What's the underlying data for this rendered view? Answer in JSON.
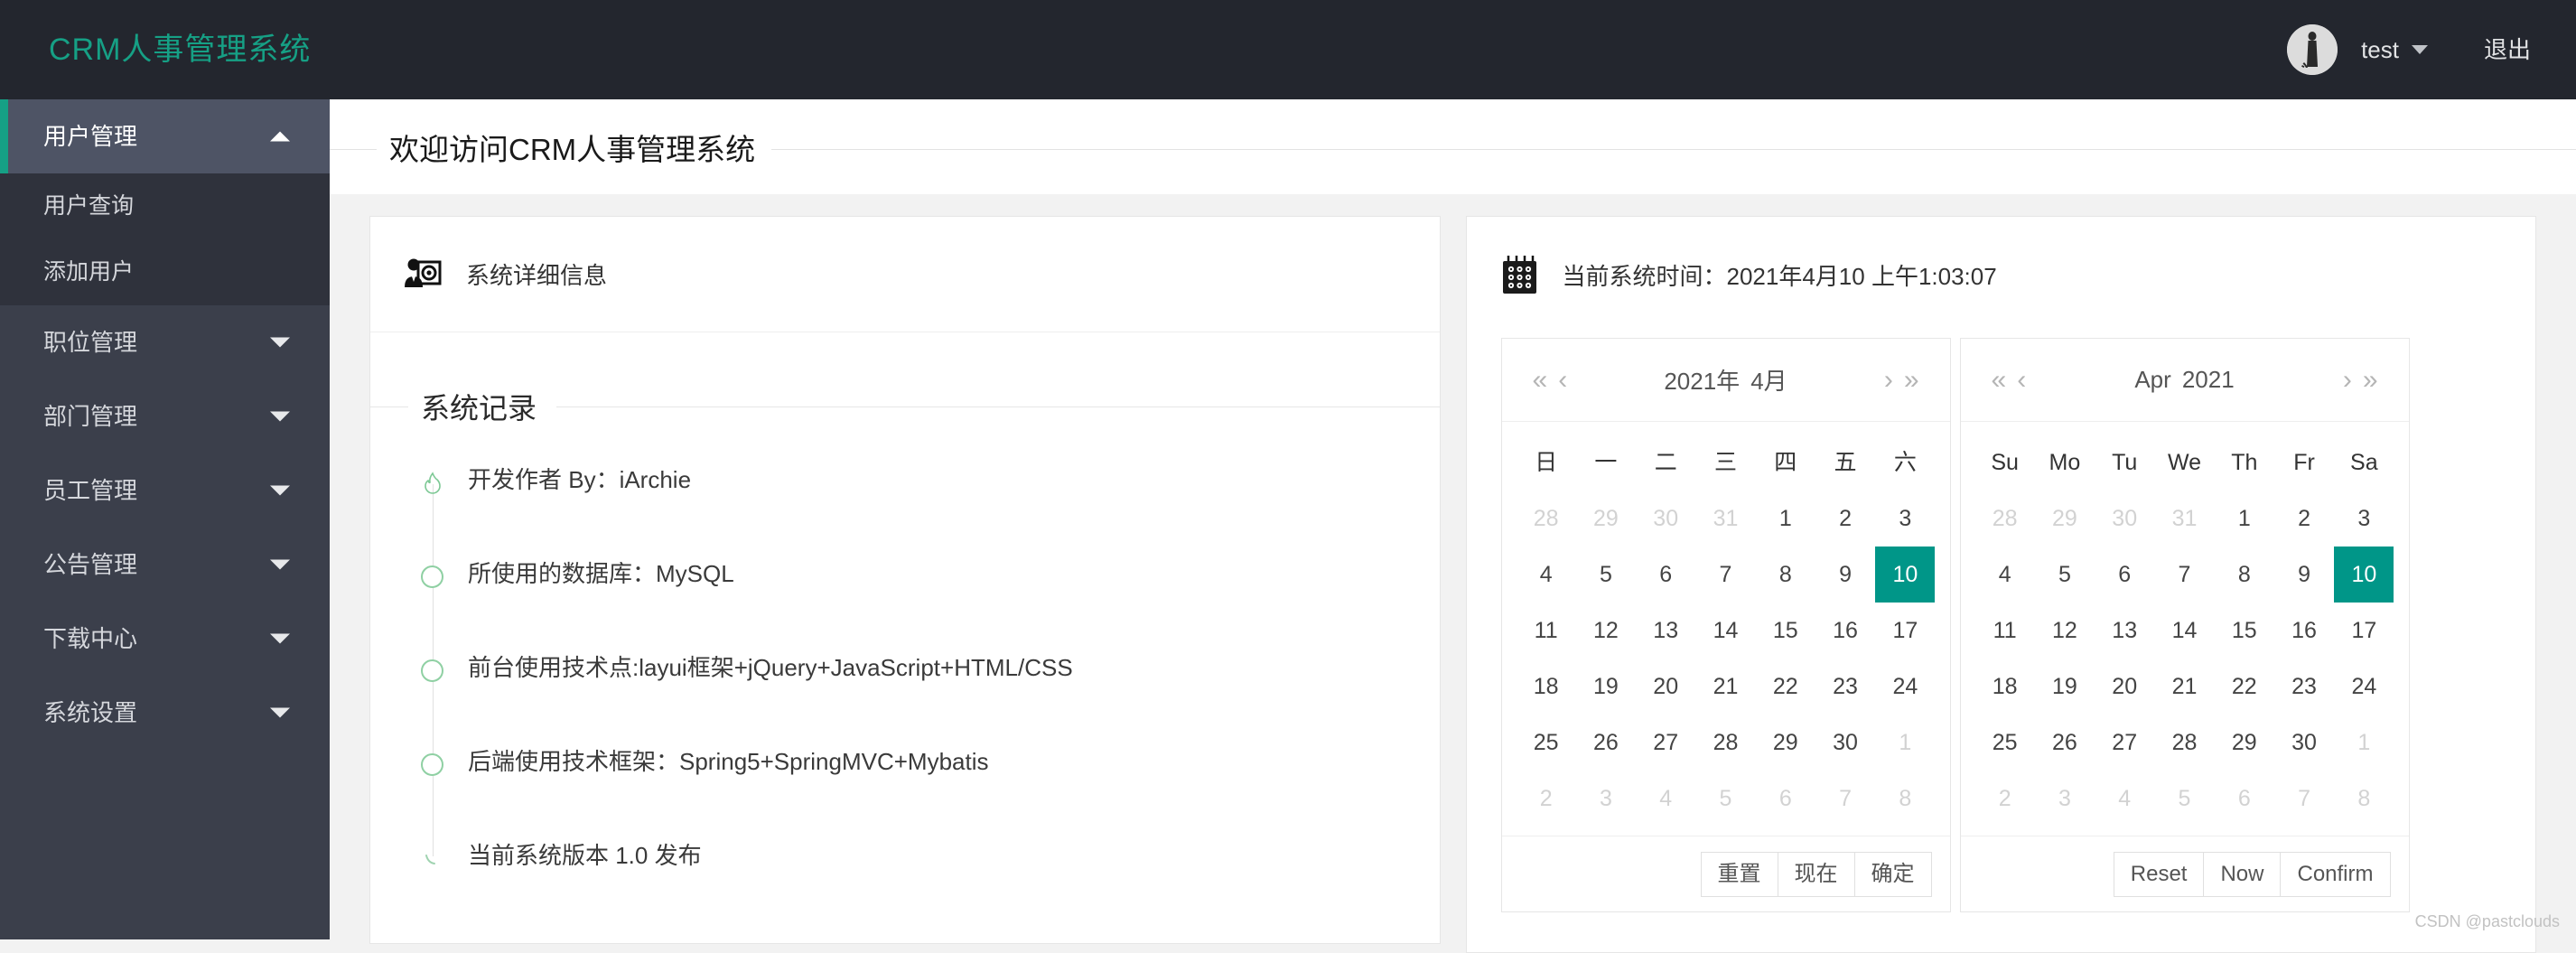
{
  "app": {
    "logo": "CRM人事管理系统",
    "accent_color": "#16a085",
    "today_color": "#009688",
    "header_bg": "#23262E",
    "sidebar_bg": "#3B3F4B"
  },
  "header": {
    "username": "test",
    "logout_label": "退出",
    "avatar_icon": "user-avatar-image"
  },
  "sidebar": {
    "items": [
      {
        "label": "用户管理",
        "state": "expanded",
        "arrow": "chevron-up-icon",
        "active": true
      },
      {
        "label": "职位管理",
        "state": "collapsed",
        "arrow": "chevron-down-icon",
        "active": false
      },
      {
        "label": "部门管理",
        "state": "collapsed",
        "arrow": "chevron-down-icon",
        "active": false
      },
      {
        "label": "员工管理",
        "state": "collapsed",
        "arrow": "chevron-down-icon",
        "active": false
      },
      {
        "label": "公告管理",
        "state": "collapsed",
        "arrow": "chevron-down-icon",
        "active": false
      },
      {
        "label": "下载中心",
        "state": "collapsed",
        "arrow": "chevron-down-icon",
        "active": false
      },
      {
        "label": "系统设置",
        "state": "collapsed",
        "arrow": "chevron-down-icon",
        "active": false
      }
    ],
    "submenu": [
      {
        "label": "用户查询"
      },
      {
        "label": "添加用户"
      }
    ]
  },
  "page": {
    "title": "欢迎访问CRM人事管理系统"
  },
  "left_card": {
    "head_icon": "user-settings-icon",
    "head_title": "系统详细信息",
    "section_title": "系统记录",
    "timeline": [
      {
        "icon": "flame-icon",
        "text": "开发作者 By：iArchie"
      },
      {
        "icon": "circle-icon",
        "text": "所使用的数据库：MySQL"
      },
      {
        "icon": "circle-icon",
        "text": "前台使用技术点:layui框架+jQuery+JavaScript+HTML/CSS"
      },
      {
        "icon": "circle-icon",
        "text": "后端使用技术框架：Spring5+SpringMVC+Mybatis"
      },
      {
        "icon": "crescent-icon",
        "text": "当前系统版本 1.0 发布"
      }
    ]
  },
  "right_card": {
    "head_icon": "calendar-icon",
    "head_title": "当前系统时间：2021年4月10 上午1:03:07",
    "calendars": [
      {
        "id": "zh",
        "nav": {
          "prev_year": "«",
          "prev_month": "‹",
          "next_month": "›",
          "next_year": "»"
        },
        "title_parts": [
          "2021年",
          "4月"
        ],
        "weekdays": [
          "日",
          "一",
          "二",
          "三",
          "四",
          "五",
          "六"
        ],
        "weeks": [
          [
            {
              "d": "28",
              "m": 1
            },
            {
              "d": "29",
              "m": 1
            },
            {
              "d": "30",
              "m": 1
            },
            {
              "d": "31",
              "m": 1
            },
            {
              "d": "1",
              "m": 0
            },
            {
              "d": "2",
              "m": 0
            },
            {
              "d": "3",
              "m": 0
            }
          ],
          [
            {
              "d": "4",
              "m": 0
            },
            {
              "d": "5",
              "m": 0
            },
            {
              "d": "6",
              "m": 0
            },
            {
              "d": "7",
              "m": 0
            },
            {
              "d": "8",
              "m": 0
            },
            {
              "d": "9",
              "m": 0
            },
            {
              "d": "10",
              "m": 0,
              "t": 1
            }
          ],
          [
            {
              "d": "11",
              "m": 0
            },
            {
              "d": "12",
              "m": 0
            },
            {
              "d": "13",
              "m": 0
            },
            {
              "d": "14",
              "m": 0
            },
            {
              "d": "15",
              "m": 0
            },
            {
              "d": "16",
              "m": 0
            },
            {
              "d": "17",
              "m": 0
            }
          ],
          [
            {
              "d": "18",
              "m": 0
            },
            {
              "d": "19",
              "m": 0
            },
            {
              "d": "20",
              "m": 0
            },
            {
              "d": "21",
              "m": 0
            },
            {
              "d": "22",
              "m": 0
            },
            {
              "d": "23",
              "m": 0
            },
            {
              "d": "24",
              "m": 0
            }
          ],
          [
            {
              "d": "25",
              "m": 0
            },
            {
              "d": "26",
              "m": 0
            },
            {
              "d": "27",
              "m": 0
            },
            {
              "d": "28",
              "m": 0
            },
            {
              "d": "29",
              "m": 0
            },
            {
              "d": "30",
              "m": 0
            },
            {
              "d": "1",
              "m": 1
            }
          ],
          [
            {
              "d": "2",
              "m": 1
            },
            {
              "d": "3",
              "m": 1
            },
            {
              "d": "4",
              "m": 1
            },
            {
              "d": "5",
              "m": 1
            },
            {
              "d": "6",
              "m": 1
            },
            {
              "d": "7",
              "m": 1
            },
            {
              "d": "8",
              "m": 1
            }
          ]
        ],
        "buttons": [
          "重置",
          "现在",
          "确定"
        ]
      },
      {
        "id": "en",
        "nav": {
          "prev_year": "«",
          "prev_month": "‹",
          "next_month": "›",
          "next_year": "»"
        },
        "title_parts": [
          "Apr",
          "2021"
        ],
        "weekdays": [
          "Su",
          "Mo",
          "Tu",
          "We",
          "Th",
          "Fr",
          "Sa"
        ],
        "weeks": [
          [
            {
              "d": "28",
              "m": 1
            },
            {
              "d": "29",
              "m": 1
            },
            {
              "d": "30",
              "m": 1
            },
            {
              "d": "31",
              "m": 1
            },
            {
              "d": "1",
              "m": 0
            },
            {
              "d": "2",
              "m": 0
            },
            {
              "d": "3",
              "m": 0
            }
          ],
          [
            {
              "d": "4",
              "m": 0
            },
            {
              "d": "5",
              "m": 0
            },
            {
              "d": "6",
              "m": 0
            },
            {
              "d": "7",
              "m": 0
            },
            {
              "d": "8",
              "m": 0
            },
            {
              "d": "9",
              "m": 0
            },
            {
              "d": "10",
              "m": 0,
              "t": 1
            }
          ],
          [
            {
              "d": "11",
              "m": 0
            },
            {
              "d": "12",
              "m": 0
            },
            {
              "d": "13",
              "m": 0
            },
            {
              "d": "14",
              "m": 0
            },
            {
              "d": "15",
              "m": 0
            },
            {
              "d": "16",
              "m": 0
            },
            {
              "d": "17",
              "m": 0
            }
          ],
          [
            {
              "d": "18",
              "m": 0
            },
            {
              "d": "19",
              "m": 0
            },
            {
              "d": "20",
              "m": 0
            },
            {
              "d": "21",
              "m": 0
            },
            {
              "d": "22",
              "m": 0
            },
            {
              "d": "23",
              "m": 0
            },
            {
              "d": "24",
              "m": 0
            }
          ],
          [
            {
              "d": "25",
              "m": 0
            },
            {
              "d": "26",
              "m": 0
            },
            {
              "d": "27",
              "m": 0
            },
            {
              "d": "28",
              "m": 0
            },
            {
              "d": "29",
              "m": 0
            },
            {
              "d": "30",
              "m": 0
            },
            {
              "d": "1",
              "m": 1
            }
          ],
          [
            {
              "d": "2",
              "m": 1
            },
            {
              "d": "3",
              "m": 1
            },
            {
              "d": "4",
              "m": 1
            },
            {
              "d": "5",
              "m": 1
            },
            {
              "d": "6",
              "m": 1
            },
            {
              "d": "7",
              "m": 1
            },
            {
              "d": "8",
              "m": 1
            }
          ]
        ],
        "buttons": [
          "Reset",
          "Now",
          "Confirm"
        ]
      }
    ]
  },
  "watermark": "CSDN @pastclouds"
}
